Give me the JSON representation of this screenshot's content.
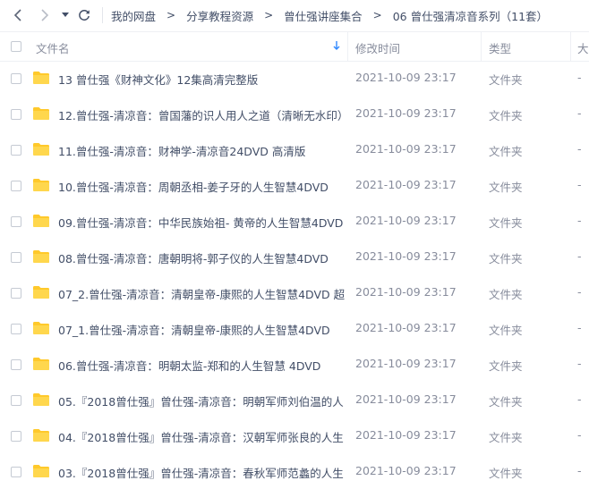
{
  "nav": {
    "breadcrumbs": [
      "我的网盘",
      "分享教程资源",
      "曾仕强讲座集合",
      "06 曾仕强清凉音系列（11套）"
    ],
    "separator": ">"
  },
  "columns": {
    "name": "文件名",
    "modified": "修改时间",
    "type": "类型",
    "size": "大"
  },
  "colors": {
    "folder": "#ffc92b",
    "sort_arrow": "#2f88ff"
  },
  "files": [
    {
      "name": "13 曾仕强《财神文化》12集高清完整版",
      "modified": "2021-10-09 23:17",
      "type": "文件夹",
      "size": "-"
    },
    {
      "name": "12.曾仕强-清凉音：曾国藩的识人用人之道（清晰无水印）",
      "modified": "2021-10-09 23:17",
      "type": "文件夹",
      "size": "-"
    },
    {
      "name": "11.曾仕强-清凉音：财神学-清凉音24DVD 高清版",
      "modified": "2021-10-09 23:17",
      "type": "文件夹",
      "size": "-"
    },
    {
      "name": "10.曾仕强-清凉音：周朝丞相-姜子牙的人生智慧4DVD",
      "modified": "2021-10-09 23:17",
      "type": "文件夹",
      "size": "-"
    },
    {
      "name": "09.曾仕强-清凉音：中华民族始祖- 黄帝的人生智慧4DVD",
      "modified": "2021-10-09 23:17",
      "type": "文件夹",
      "size": "-"
    },
    {
      "name": "08.曾仕强-清凉音：唐朝明将-郭子仪的人生智慧4DVD",
      "modified": "2021-10-09 23:17",
      "type": "文件夹",
      "size": "-"
    },
    {
      "name": "07_2.曾仕强-清凉音：清朝皇帝-康熙的人生智慧4DVD 超...",
      "modified": "2021-10-09 23:17",
      "type": "文件夹",
      "size": "-"
    },
    {
      "name": "07_1.曾仕强-清凉音：清朝皇帝-康熙的人生智慧4DVD",
      "modified": "2021-10-09 23:17",
      "type": "文件夹",
      "size": "-"
    },
    {
      "name": "06.曾仕强-清凉音：明朝太监-郑和的人生智慧 4DVD",
      "modified": "2021-10-09 23:17",
      "type": "文件夹",
      "size": "-"
    },
    {
      "name": "05.『2018曾仕强』曾仕强-清凉音：明朝军师刘伯温的人...",
      "modified": "2021-10-09 23:17",
      "type": "文件夹",
      "size": "-"
    },
    {
      "name": "04.『2018曾仕强』曾仕强-清凉音：汉朝军师张良的人生...",
      "modified": "2021-10-09 23:17",
      "type": "文件夹",
      "size": "-"
    },
    {
      "name": "03.『2018曾仕强』曾仕强-清凉音：春秋军师范蠡的人生...",
      "modified": "2021-10-09 23:17",
      "type": "文件夹",
      "size": "-"
    }
  ]
}
